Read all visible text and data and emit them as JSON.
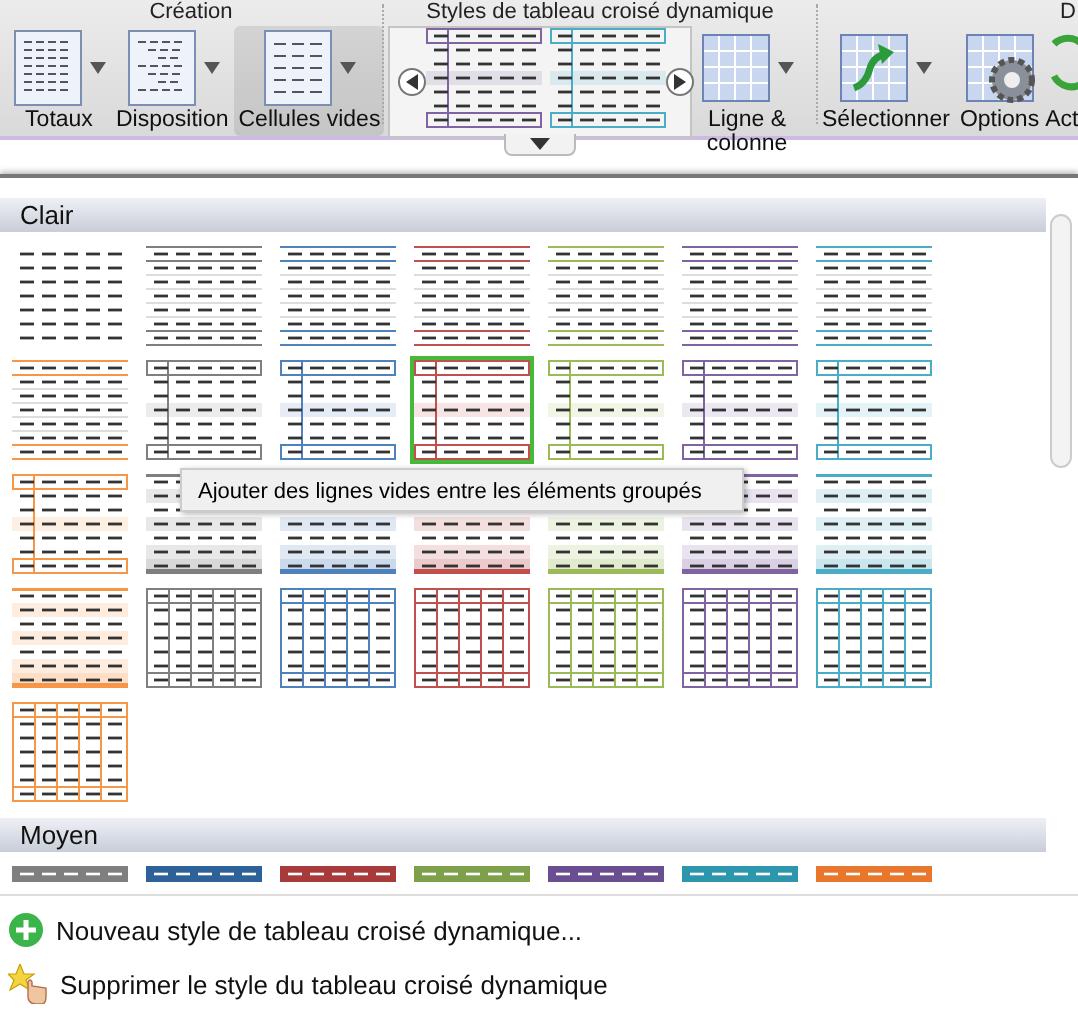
{
  "ribbon": {
    "groups": [
      {
        "label": "Création",
        "buttons": [
          {
            "label": "Totaux",
            "kind": "totals",
            "dropdown": true,
            "pressed": false
          },
          {
            "label": "Disposition",
            "kind": "layout",
            "dropdown": true,
            "pressed": false
          },
          {
            "label": "Cellules vides",
            "kind": "blank-cells",
            "dropdown": true,
            "pressed": true
          }
        ]
      },
      {
        "label": "Styles de tableau croisé dynamique",
        "gallery": [
          {
            "kind": "header-grid",
            "color": "#8064a2"
          },
          {
            "kind": "header-grid",
            "color": "#4bacc6"
          }
        ],
        "buttons": [
          {
            "label": "Ligne & colonne",
            "kind": "row-column",
            "dropdown": true,
            "pressed": false
          }
        ]
      },
      {
        "label": "D",
        "buttons": [
          {
            "label": "Sélectionner",
            "kind": "select",
            "dropdown": true,
            "pressed": false
          },
          {
            "label": "Options",
            "kind": "options",
            "dropdown": false,
            "pressed": false
          },
          {
            "label": "Act",
            "kind": "refresh",
            "dropdown": false,
            "pressed": false
          }
        ]
      }
    ]
  },
  "gallery": {
    "sections": [
      {
        "title": "Clair",
        "styles": [
          {
            "kind": "plain",
            "selected": false
          },
          {
            "kind": "rules",
            "color": "#7f7f7f",
            "selected": false
          },
          {
            "kind": "rules",
            "color": "#4f81bd",
            "selected": false
          },
          {
            "kind": "rules",
            "color": "#c0504d",
            "selected": false
          },
          {
            "kind": "rules",
            "color": "#9bbb59",
            "selected": false
          },
          {
            "kind": "rules",
            "color": "#8064a2",
            "selected": false
          },
          {
            "kind": "rules",
            "color": "#4bacc6",
            "selected": false
          },
          {
            "kind": "rules",
            "color": "#f79646",
            "selected": false
          },
          {
            "kind": "header-grid",
            "color": "#7f7f7f",
            "selected": false
          },
          {
            "kind": "header-grid",
            "color": "#4f81bd",
            "selected": false
          },
          {
            "kind": "header-grid",
            "color": "#c0504d",
            "selected": true
          },
          {
            "kind": "header-grid",
            "color": "#9bbb59",
            "selected": false
          },
          {
            "kind": "header-grid",
            "color": "#8064a2",
            "selected": false
          },
          {
            "kind": "header-grid",
            "color": "#4bacc6",
            "selected": false
          },
          {
            "kind": "header-grid",
            "color": "#f79646",
            "selected": false
          },
          {
            "kind": "banded",
            "color": "#7f7f7f",
            "selected": false
          },
          {
            "kind": "banded",
            "color": "#4f81bd",
            "selected": false
          },
          {
            "kind": "banded",
            "color": "#c0504d",
            "selected": false
          },
          {
            "kind": "banded",
            "color": "#9bbb59",
            "selected": false
          },
          {
            "kind": "banded",
            "color": "#8064a2",
            "selected": false
          },
          {
            "kind": "banded",
            "color": "#4bacc6",
            "selected": false
          },
          {
            "kind": "banded",
            "color": "#f79646",
            "selected": false
          },
          {
            "kind": "column-grid",
            "color": "#7f7f7f",
            "selected": false
          },
          {
            "kind": "column-grid",
            "color": "#4f81bd",
            "selected": false
          },
          {
            "kind": "column-grid",
            "color": "#c0504d",
            "selected": false
          },
          {
            "kind": "column-grid",
            "color": "#9bbb59",
            "selected": false
          },
          {
            "kind": "column-grid",
            "color": "#8064a2",
            "selected": false
          },
          {
            "kind": "column-grid",
            "color": "#4bacc6",
            "selected": false
          },
          {
            "kind": "column-grid",
            "color": "#f79646",
            "selected": false
          }
        ]
      },
      {
        "title": "Moyen",
        "styles": [
          {
            "kind": "strip",
            "color": "#7f7f7f",
            "selected": false
          },
          {
            "kind": "strip",
            "color": "#2f6199",
            "selected": false
          },
          {
            "kind": "strip",
            "color": "#a83a3a",
            "selected": false
          },
          {
            "kind": "strip",
            "color": "#7ea04a",
            "selected": false
          },
          {
            "kind": "strip",
            "color": "#6a4e91",
            "selected": false
          },
          {
            "kind": "strip",
            "color": "#2c96ad",
            "selected": false
          },
          {
            "kind": "strip",
            "color": "#e8762b",
            "selected": false
          }
        ]
      }
    ],
    "tooltip": "Ajouter des lignes vides entre les éléments groupés"
  },
  "menu": [
    {
      "label": "Nouveau style de tableau croisé dynamique...",
      "kind": "new"
    },
    {
      "label": "Supprimer le style du tableau croisé dynamique",
      "kind": "clear"
    }
  ]
}
